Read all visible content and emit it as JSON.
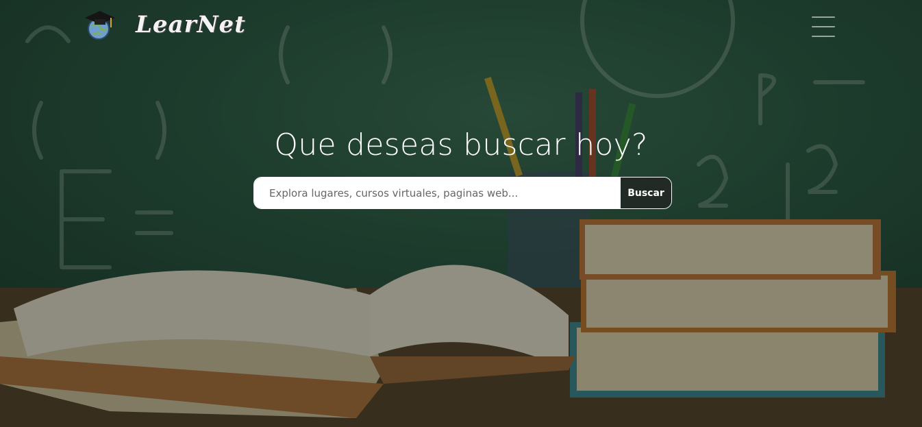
{
  "navbar": {
    "brand_name": "LearNet",
    "logo_icon": "graduation-cap-globe-icon",
    "menu_icon": "hamburger-menu-icon"
  },
  "hero": {
    "title": "Que deseas buscar hoy?"
  },
  "search": {
    "placeholder": "Explora lugares, cursos virtuales, paginas web...",
    "value": "",
    "button_label": "Buscar"
  },
  "colors": {
    "chalkboard": "#2c5a43",
    "desk": "#5b4229",
    "search_button": "#222a25",
    "text": "#ffffff"
  }
}
